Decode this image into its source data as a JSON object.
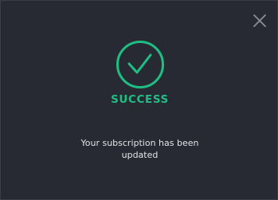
{
  "dialog": {
    "title": "SUCCESS",
    "message": "Your subscription has been updated",
    "icons": {
      "status": "check-circle-icon",
      "close": "close-icon"
    },
    "colors": {
      "background": "#272933",
      "accent": "#1fbf84",
      "text": "#e3e4e8",
      "close_icon": "#8e9099"
    }
  }
}
